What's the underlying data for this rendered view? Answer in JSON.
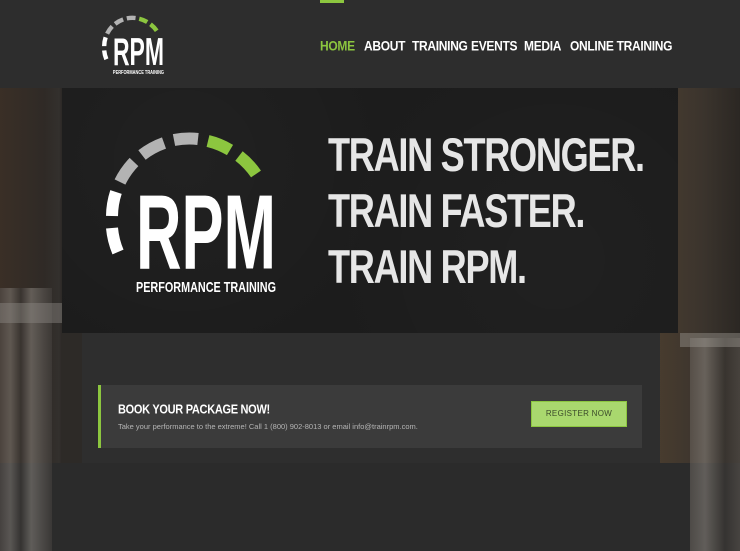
{
  "brand": {
    "logo_text": "RPM",
    "logo_subtext": "PERFORMANCE TRAINING",
    "accent_color": "#8cc63f",
    "gauge_grey": "#b3b3b3"
  },
  "nav": {
    "items": [
      {
        "label": "HOME",
        "active": true
      },
      {
        "label": "ABOUT",
        "active": false
      },
      {
        "label": "TRAINING",
        "active": false
      },
      {
        "label": "EVENTS",
        "active": false
      },
      {
        "label": "MEDIA",
        "active": false
      },
      {
        "label": "ONLINE TRAINING",
        "active": false
      }
    ]
  },
  "hero": {
    "lines": [
      "TRAIN STRONGER.",
      "TRAIN FASTER.",
      "TRAIN RPM."
    ]
  },
  "cta": {
    "title": "BOOK YOUR PACKAGE NOW!",
    "description": "Take your performance to the extreme! Call 1 (800) 902-8013 or email info@trainrpm.com.",
    "button_label": "REGISTER NOW"
  }
}
